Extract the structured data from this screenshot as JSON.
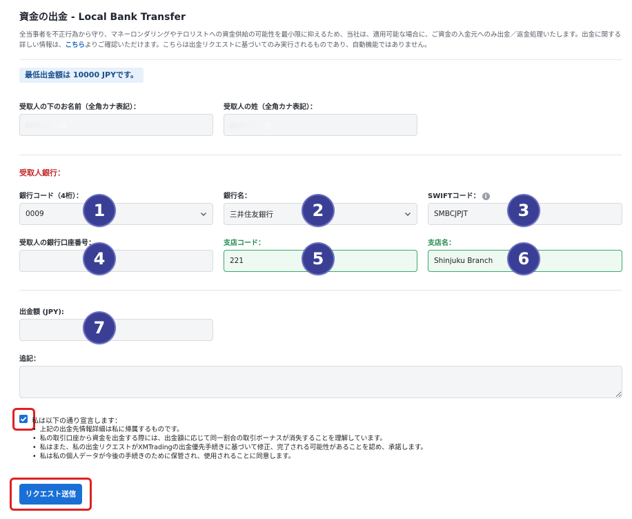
{
  "header": {
    "title": "資金の出金 - Local Bank Transfer",
    "desc_before_link": "全当事者を不正行為から守り、マネーロンダリングやテロリストへの資金供給の可能性を最小限に抑えるため、当社は、適用可能な場合に、ご資金の入金元へのみ出金／返金処理いたします。出金に関する詳しい情報は、",
    "desc_link": "こちら",
    "desc_after_link": "よりご確認いただけます。こちらは出金リクエストに基づいてのみ実行されるものであり、自動機能ではありません。"
  },
  "min_amount_notice": "最低出金額は 10000 JPYです。",
  "recipient": {
    "first_name_label": "受取人の下のお名前（全角カナ表記）：",
    "last_name_label": "受取人の姓（全角カナ表記）："
  },
  "bank_section": {
    "title": "受取人銀行：",
    "bank_code_label": "銀行コード（4桁）：",
    "bank_code_value": "0009",
    "bank_name_label": "銀行名：",
    "bank_name_value": "三井住友銀行",
    "swift_label": "SWIFTコード：",
    "swift_value": "SMBCJPJT",
    "account_label": "受取人の銀行口座番号：",
    "account_value": "",
    "branch_code_label": "支店コード：",
    "branch_code_value": "221",
    "branch_name_label": "支店名：",
    "branch_name_value": "Shinjuku Branch"
  },
  "amount": {
    "label": "出金額 (JPY):",
    "value": ""
  },
  "notes": {
    "label": "追記：",
    "value": ""
  },
  "declaration": {
    "checked": true,
    "title": "私は以下の通り宣言します：",
    "items": [
      "上記の出金先情報詳細は私に帰属するものです。",
      "私の取引口座から資金を出金する際には、出金額に応じて同一割合の取引ボーナスが消失することを理解しています。",
      "私はまた、私の出金リクエストがXMTradingの出金優先手続きに基づいて修正、完了される可能性があることを認め、承諾します。",
      "私は私の個人データが今後の手続きのために保管され、使用されることに同意します。"
    ]
  },
  "submit_label": "リクエスト送信",
  "annotation_badges": [
    "1",
    "2",
    "3",
    "4",
    "5",
    "6",
    "7"
  ],
  "colors": {
    "accent": "#1a6fd6",
    "section_red": "#c62828",
    "green_label": "#1b8a4a",
    "badge": "#3a3f95",
    "highlight_box": "#e02020"
  }
}
